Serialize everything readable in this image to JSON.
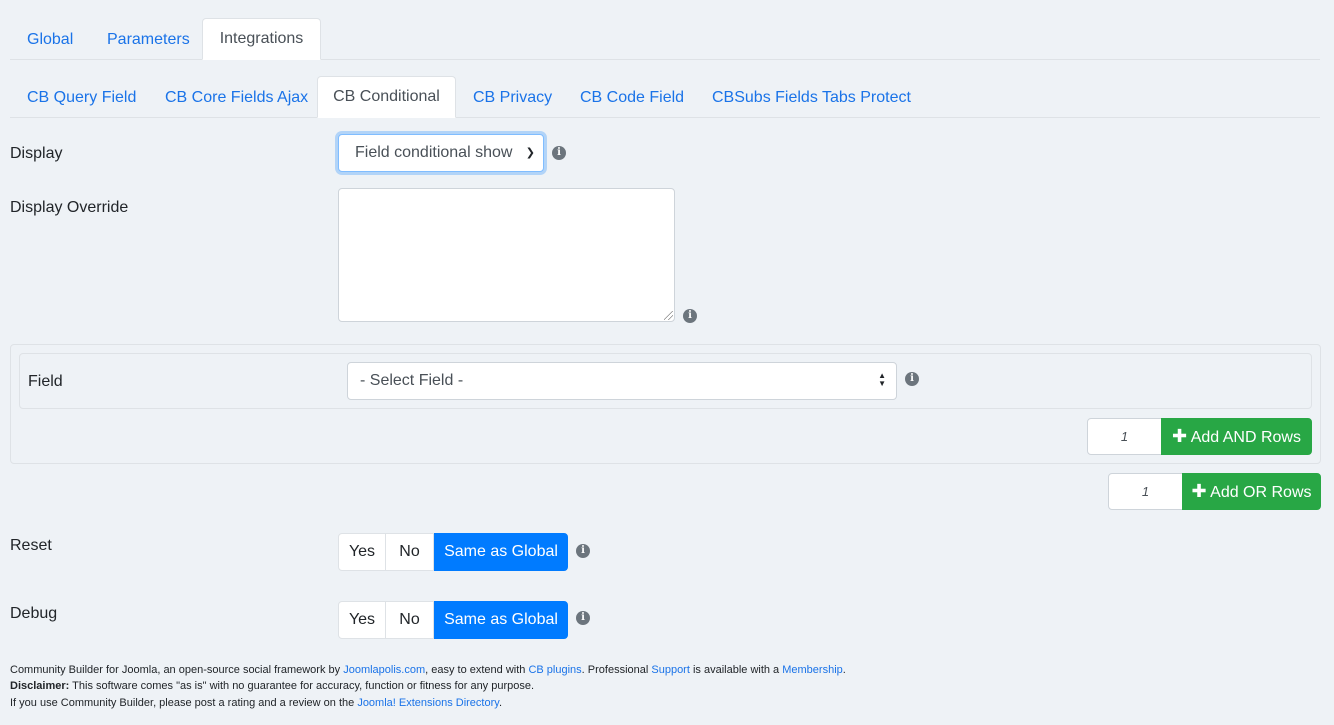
{
  "top_tabs": [
    {
      "label": "Global",
      "active": false
    },
    {
      "label": "Parameters",
      "active": false
    },
    {
      "label": "Integrations",
      "active": true
    }
  ],
  "sub_tabs": [
    {
      "label": "CB Query Field",
      "active": false
    },
    {
      "label": "CB Core Fields Ajax",
      "active": false
    },
    {
      "label": "CB Conditional",
      "active": true
    },
    {
      "label": "CB Privacy",
      "active": false
    },
    {
      "label": "CB Code Field",
      "active": false
    },
    {
      "label": "CBSubs Fields Tabs Protect",
      "active": false
    }
  ],
  "display": {
    "label": "Display",
    "value": "Field conditional show"
  },
  "display_override": {
    "label": "Display Override",
    "value": ""
  },
  "field_row": {
    "label": "Field",
    "value": "- Select Field -"
  },
  "add_and": {
    "count": "1",
    "label": "Add AND Rows"
  },
  "add_or": {
    "count": "1",
    "label": "Add OR Rows"
  },
  "reset": {
    "label": "Reset",
    "options": [
      "Yes",
      "No",
      "Same as Global"
    ],
    "selected": "Same as Global"
  },
  "debug": {
    "label": "Debug",
    "options": [
      "Yes",
      "No",
      "Same as Global"
    ],
    "selected": "Same as Global"
  },
  "info_glyph": "i",
  "footer": {
    "line1": {
      "t1": "Community Builder for Joomla, an open-source social framework by ",
      "link1": "Joomlapolis.com",
      "t2": ", easy to extend with ",
      "link2": "CB plugins",
      "t3": ". Professional ",
      "link3": "Support",
      "t4": " is available with a ",
      "link4": "Membership",
      "t5": "."
    },
    "line2": {
      "bold": "Disclaimer:",
      "text": " This software comes \"as is\" with no guarantee for accuracy, function or fitness for any purpose."
    },
    "line3": {
      "t1": "If you use Community Builder, please post a rating and a review on the ",
      "link": "Joomla! Extensions Directory",
      "t2": "."
    }
  },
  "colors": {
    "background": "#eef2f6",
    "link": "#1a73e8",
    "primary": "#007bff",
    "success": "#28a745"
  }
}
